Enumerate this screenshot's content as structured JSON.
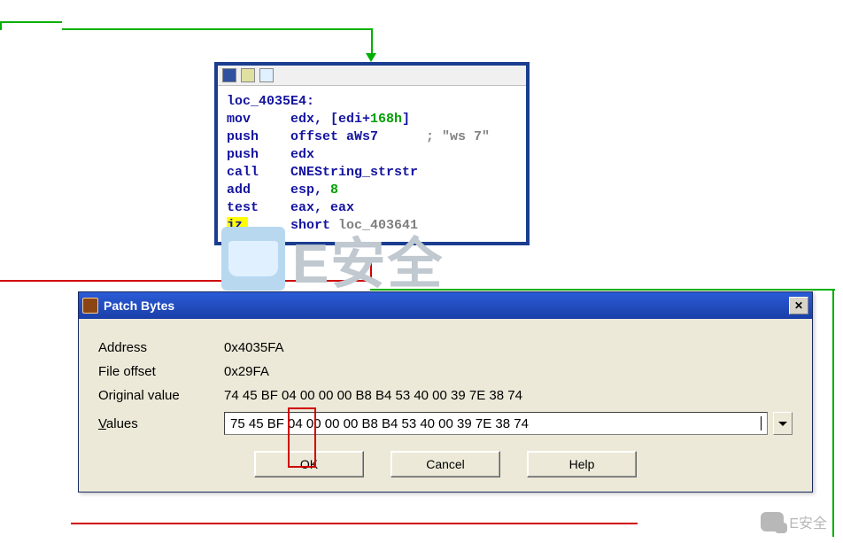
{
  "disasm": {
    "label": "loc_4035E4:",
    "lines": [
      {
        "m": "mov",
        "args_pre": "edx, [edi+",
        "num": "168h",
        "args_post": "]"
      },
      {
        "m": "push",
        "args": "offset aWs7",
        "comment": "; \"ws 7\""
      },
      {
        "m": "push",
        "args": "edx"
      },
      {
        "m": "call",
        "args": "CNEString_strstr"
      },
      {
        "m": "add",
        "args_pre": "esp, ",
        "num": "8"
      },
      {
        "m": "test",
        "args": "eax, eax"
      },
      {
        "m": "jz",
        "hl": true,
        "args_pre": "short ",
        "gray": "loc_403641"
      }
    ]
  },
  "watermark": "E安全",
  "dialog": {
    "title": "Patch Bytes",
    "address_label": "Address",
    "address_value": "0x4035FA",
    "fileoffset_label": "File offset",
    "fileoffset_value": "0x29FA",
    "original_label": "Original value",
    "original_value": "74 45 BF 04 00 00 00 B8 B4 53 40 00 39 7E 38 74",
    "values_label": "Values",
    "values_value": "75 45 BF 04 00 00 00 B8 B4 53 40 00 39 7E 38 74",
    "ok": "OK",
    "cancel": "Cancel",
    "help": "Help"
  },
  "wechat_text": "E安全"
}
